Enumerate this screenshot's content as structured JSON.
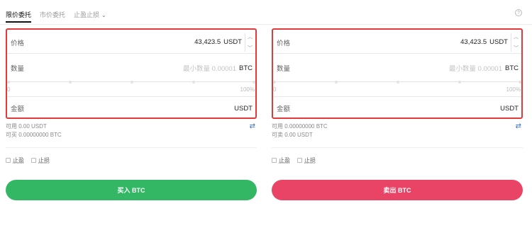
{
  "tabs": [
    {
      "label": "限价委托",
      "active": true
    },
    {
      "label": "市价委托",
      "active": false
    },
    {
      "label": "止盈止损",
      "active": false
    }
  ],
  "icons": {
    "help": "question-circle-icon",
    "stepper_up": "chevron-up-icon",
    "stepper_down": "chevron-down-icon",
    "swap": "swap-arrows-icon"
  },
  "buy": {
    "price_label": "价格",
    "price_value": "43,423.5",
    "price_unit": "USDT",
    "amount_label": "数量",
    "amount_placeholder": "最小数量 0.00001",
    "amount_unit": "BTC",
    "slider_min": "0",
    "slider_max": "100%",
    "total_label": "金额",
    "total_unit": "USDT",
    "available": "可用 0.00 USDT",
    "can_buy": "可买 0.00000000 BTC",
    "take_profit": "止盈",
    "stop_loss": "止损",
    "button": "买入 BTC"
  },
  "sell": {
    "price_label": "价格",
    "price_value": "43,423.5",
    "price_unit": "USDT",
    "amount_label": "数量",
    "amount_placeholder": "最小数量 0.00001",
    "amount_unit": "BTC",
    "slider_min": "0",
    "slider_max": "100%",
    "total_label": "金额",
    "total_unit": "USDT",
    "available": "可用 0.00000000 BTC",
    "can_sell": "可卖 0.00 USDT",
    "take_profit": "止盈",
    "stop_loss": "止损",
    "button": "卖出 BTC"
  },
  "colors": {
    "buy": "#33b765",
    "sell": "#e94465",
    "highlight_border": "#e03a3a"
  }
}
